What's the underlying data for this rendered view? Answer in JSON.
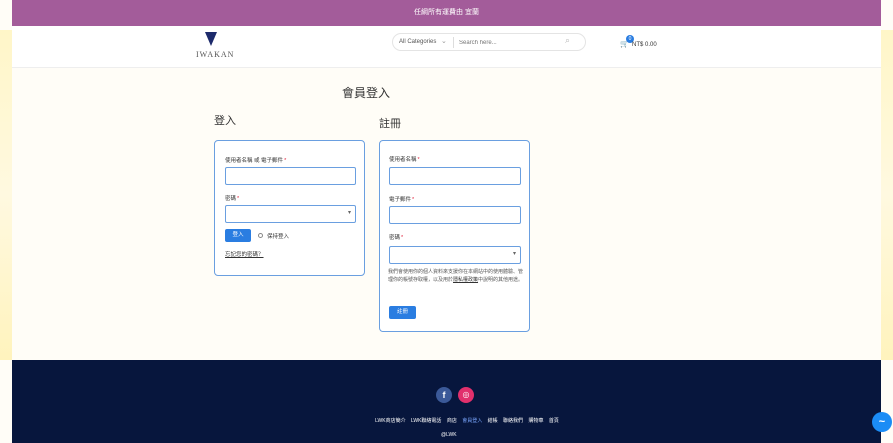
{
  "topbar": {
    "text": "任綱所有運費由 宜蘭"
  },
  "header": {
    "logo_text": "IWAKAN",
    "search": {
      "category": "All Categories",
      "placeholder": "Search here..."
    },
    "cart": {
      "count": "0",
      "amount": "NT$ 0.00"
    }
  },
  "page": {
    "title": "會員登入"
  },
  "login": {
    "heading": "登入",
    "username_label": "使用者名稱 或 電子郵件",
    "password_label": "密碼",
    "submit": "登入",
    "remember": "保持登入",
    "forgot": "忘記您的密碼？",
    "required_mark": "*"
  },
  "register": {
    "heading": "註冊",
    "username_label": "使用者名稱",
    "email_label": "電子郵件",
    "password_label": "密碼",
    "required_mark": "*",
    "privacy_text_1": "我們會使用你的個人資料來支援你在本網站中的使用體驗、管理你的帳號存取權，以及用於",
    "privacy_link": "隱私權政策",
    "privacy_text_2": "中說明的其他用途。",
    "submit": "註冊"
  },
  "footer": {
    "social": [
      {
        "name": "facebook",
        "glyph": "f"
      },
      {
        "name": "instagram",
        "glyph": "◎"
      }
    ],
    "nav": [
      {
        "label": "LWK商店簡介",
        "active": false
      },
      {
        "label": "LWK聯絡電話",
        "active": false
      },
      {
        "label": "商店",
        "active": false
      },
      {
        "label": "會員登入",
        "active": true
      },
      {
        "label": "結帳",
        "active": false
      },
      {
        "label": "聯絡我們",
        "active": false
      },
      {
        "label": "購物車",
        "active": false
      },
      {
        "label": "首頁",
        "active": false
      }
    ],
    "copyright": "@LWK"
  },
  "messenger": {
    "glyph": "~"
  },
  "colors": {
    "topbar": "#a35c9a",
    "accent": "#2a7de1",
    "footer": "#07163d",
    "required": "#e0213b"
  }
}
